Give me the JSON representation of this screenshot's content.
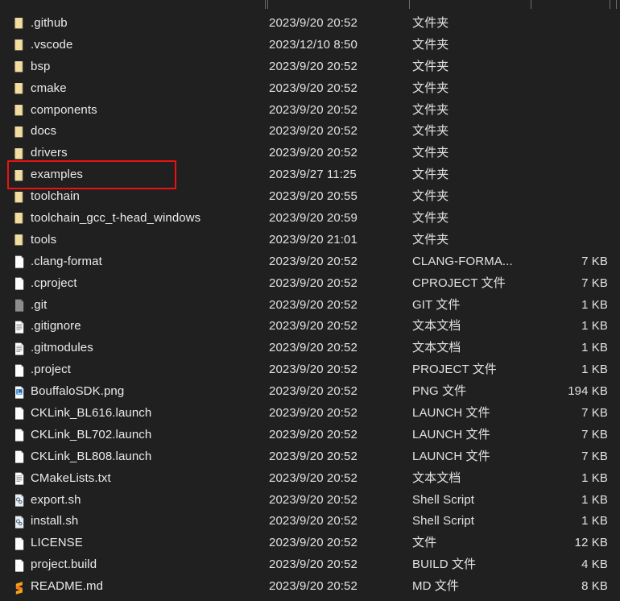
{
  "window": {
    "background_color": "#202020",
    "text_color": "#e6e6e6",
    "highlight_color": "#ee1111"
  },
  "columns": {
    "headers": [
      "",
      "",
      "",
      ""
    ],
    "divider_positions": [
      329,
      332,
      508,
      659,
      757,
      765
    ]
  },
  "highlight": {
    "target_row_name": "examples",
    "color": "#ee1111"
  },
  "rows": [
    {
      "icon": "folder-icon",
      "name": ".github",
      "date": "2023/9/20 20:52",
      "type": "文件夹",
      "size": ""
    },
    {
      "icon": "folder-icon",
      "name": ".vscode",
      "date": "2023/12/10 8:50",
      "type": "文件夹",
      "size": ""
    },
    {
      "icon": "folder-icon",
      "name": "bsp",
      "date": "2023/9/20 20:52",
      "type": "文件夹",
      "size": ""
    },
    {
      "icon": "folder-icon",
      "name": "cmake",
      "date": "2023/9/20 20:52",
      "type": "文件夹",
      "size": ""
    },
    {
      "icon": "folder-icon",
      "name": "components",
      "date": "2023/9/20 20:52",
      "type": "文件夹",
      "size": ""
    },
    {
      "icon": "folder-icon",
      "name": "docs",
      "date": "2023/9/20 20:52",
      "type": "文件夹",
      "size": ""
    },
    {
      "icon": "folder-icon",
      "name": "drivers",
      "date": "2023/9/20 20:52",
      "type": "文件夹",
      "size": ""
    },
    {
      "icon": "folder-icon",
      "name": "examples",
      "date": "2023/9/27 11:25",
      "type": "文件夹",
      "size": ""
    },
    {
      "icon": "folder-icon",
      "name": "toolchain",
      "date": "2023/9/20 20:55",
      "type": "文件夹",
      "size": ""
    },
    {
      "icon": "folder-icon",
      "name": "toolchain_gcc_t-head_windows",
      "date": "2023/9/20 20:59",
      "type": "文件夹",
      "size": ""
    },
    {
      "icon": "folder-icon",
      "name": "tools",
      "date": "2023/9/20 21:01",
      "type": "文件夹",
      "size": ""
    },
    {
      "icon": "file-blank-icon",
      "name": ".clang-format",
      "date": "2023/9/20 20:52",
      "type": "CLANG-FORMA...",
      "size": "7 KB"
    },
    {
      "icon": "file-blank-icon",
      "name": ".cproject",
      "date": "2023/9/20 20:52",
      "type": "CPROJECT 文件",
      "size": "7 KB"
    },
    {
      "icon": "file-grey-icon",
      "name": ".git",
      "date": "2023/9/20 20:52",
      "type": "GIT 文件",
      "size": "1 KB"
    },
    {
      "icon": "file-text-icon",
      "name": ".gitignore",
      "date": "2023/9/20 20:52",
      "type": "文本文档",
      "size": "1 KB"
    },
    {
      "icon": "file-text-icon",
      "name": ".gitmodules",
      "date": "2023/9/20 20:52",
      "type": "文本文档",
      "size": "1 KB"
    },
    {
      "icon": "file-blank-icon",
      "name": ".project",
      "date": "2023/9/20 20:52",
      "type": "PROJECT 文件",
      "size": "1 KB"
    },
    {
      "icon": "file-image-icon",
      "name": "BouffaloSDK.png",
      "date": "2023/9/20 20:52",
      "type": "PNG 文件",
      "size": "194 KB"
    },
    {
      "icon": "file-blank-icon",
      "name": "CKLink_BL616.launch",
      "date": "2023/9/20 20:52",
      "type": "LAUNCH 文件",
      "size": "7 KB"
    },
    {
      "icon": "file-blank-icon",
      "name": "CKLink_BL702.launch",
      "date": "2023/9/20 20:52",
      "type": "LAUNCH 文件",
      "size": "7 KB"
    },
    {
      "icon": "file-blank-icon",
      "name": "CKLink_BL808.launch",
      "date": "2023/9/20 20:52",
      "type": "LAUNCH 文件",
      "size": "7 KB"
    },
    {
      "icon": "file-text-icon",
      "name": "CMakeLists.txt",
      "date": "2023/9/20 20:52",
      "type": "文本文档",
      "size": "1 KB"
    },
    {
      "icon": "file-script-icon",
      "name": "export.sh",
      "date": "2023/9/20 20:52",
      "type": "Shell Script",
      "size": "1 KB"
    },
    {
      "icon": "file-script-icon",
      "name": "install.sh",
      "date": "2023/9/20 20:52",
      "type": "Shell Script",
      "size": "1 KB"
    },
    {
      "icon": "file-blank-icon",
      "name": "LICENSE",
      "date": "2023/9/20 20:52",
      "type": "文件",
      "size": "12 KB"
    },
    {
      "icon": "file-blank-icon",
      "name": "project.build",
      "date": "2023/9/20 20:52",
      "type": "BUILD 文件",
      "size": "4 KB"
    },
    {
      "icon": "file-sublime-icon",
      "name": "README.md",
      "date": "2023/9/20 20:52",
      "type": "MD 文件",
      "size": "8 KB"
    }
  ]
}
